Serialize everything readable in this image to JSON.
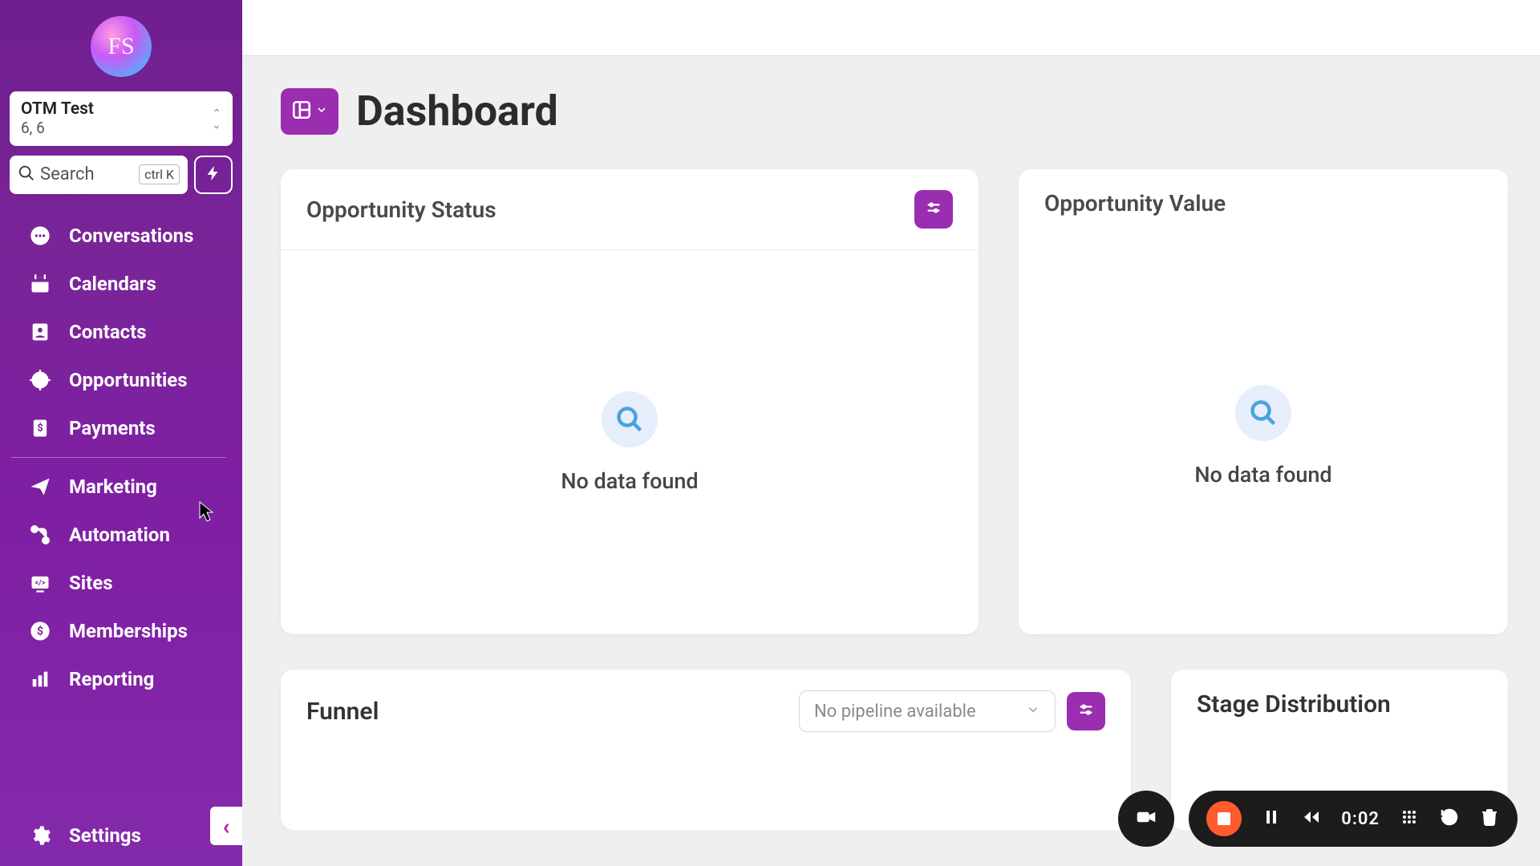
{
  "brand": {
    "logo_text": "FS"
  },
  "account": {
    "name": "OTM Test",
    "sub": "6, 6"
  },
  "search": {
    "placeholder": "Search",
    "shortcut": "ctrl K"
  },
  "sidebar": {
    "items_top": [
      {
        "label": "Conversations",
        "icon": "chat-bubble"
      },
      {
        "label": "Calendars",
        "icon": "calendar"
      },
      {
        "label": "Contacts",
        "icon": "address-book"
      },
      {
        "label": "Opportunities",
        "icon": "target"
      },
      {
        "label": "Payments",
        "icon": "receipt-dollar"
      }
    ],
    "items_bottom": [
      {
        "label": "Marketing",
        "icon": "paper-plane"
      },
      {
        "label": "Automation",
        "icon": "flow"
      },
      {
        "label": "Sites",
        "icon": "site-code"
      },
      {
        "label": "Memberships",
        "icon": "badge-dollar"
      },
      {
        "label": "Reporting",
        "icon": "bar-chart"
      }
    ],
    "settings_label": "Settings"
  },
  "page": {
    "title": "Dashboard"
  },
  "cards": {
    "opportunity_status": {
      "title": "Opportunity Status",
      "empty": "No data found"
    },
    "opportunity_value": {
      "title": "Opportunity Value",
      "empty": "No data found"
    },
    "funnel": {
      "title": "Funnel",
      "pipeline_placeholder": "No pipeline available"
    },
    "stage": {
      "title": "Stage Distribution"
    }
  },
  "recorder": {
    "time": "0:02"
  },
  "colors": {
    "brand_purple": "#9a2db0",
    "sidebar_grad_a": "#6f1e8f",
    "sidebar_grad_b": "#832aaa",
    "accent_pink": "#c31da9",
    "rec_orange": "#ff5b2e"
  }
}
